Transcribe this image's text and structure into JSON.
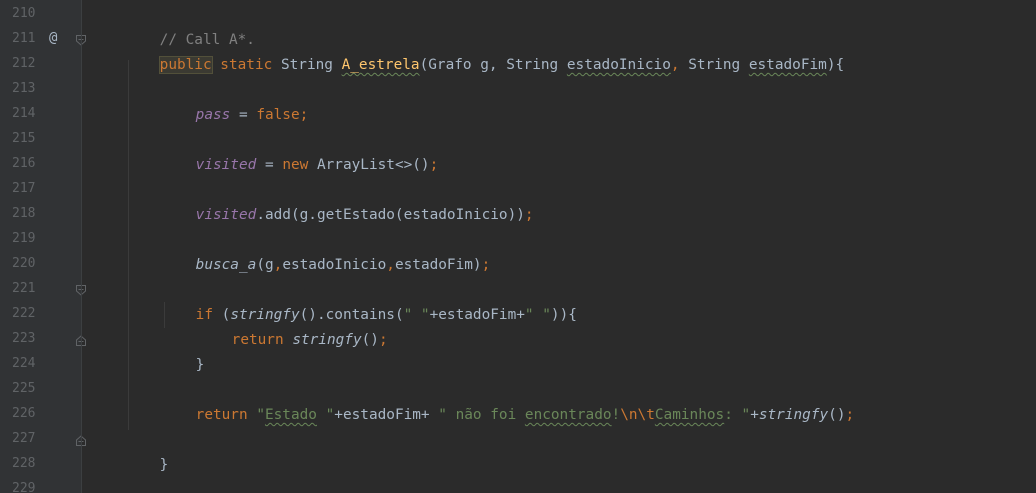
{
  "gutter": {
    "line_numbers": [
      "210",
      "211",
      "212",
      "213",
      "214",
      "215",
      "216",
      "217",
      "218",
      "219",
      "220",
      "221",
      "222",
      "223",
      "224",
      "225",
      "226",
      "227",
      "228",
      "229"
    ],
    "override_marker": "@"
  },
  "code": {
    "l210": {
      "comment": "// Call A*."
    },
    "l211": {
      "kw_public": "public",
      "kw_static": " static ",
      "type_string": "String ",
      "method_name": "A_estrela",
      "params_open": "(Grafo g, String ",
      "param_inicio": "estadoInicio",
      "comma": ", ",
      "type_string2": "String ",
      "param_fim": "estadoFim",
      "params_close": "){"
    },
    "l213": {
      "field": "pass",
      "op": " = ",
      "val": "false",
      "semi": ";"
    },
    "l215": {
      "field": "visited",
      "op": " = ",
      "kw_new": "new ",
      "rest": "ArrayList<>()",
      "semi": ";"
    },
    "l217": {
      "field": "visited",
      "rest": ".add(g.getEstado(estadoInicio))",
      "semi": ";"
    },
    "l219": {
      "call": "busca_a",
      "open": "(g",
      "c1": ",",
      "arg1": "estadoInicio",
      "c2": ",",
      "arg2": "estadoFim)",
      "semi": ";"
    },
    "l221": {
      "kw_if": "if ",
      "open": "(",
      "call": "stringfy",
      "mid": "().contains(",
      "s1": "\" \"",
      "concat": "+estadoFim+",
      "s2": "\" \"",
      "close": ")){"
    },
    "l222": {
      "kw_return": "return ",
      "call": "stringfy",
      "rest": "()",
      "semi": ";"
    },
    "l223": {
      "brace": "}"
    },
    "l225": {
      "kw_return": "return ",
      "s_open": "\"",
      "s_word": "Estado",
      "s_end": " \"",
      "concat1": "+estadoFim+ ",
      "s2_a": "\" não foi ",
      "s2_word": "encontrado",
      "s2_b": "!",
      "esc": "\\n\\t",
      "s2_word2": "Caminhos",
      "s2_c": ": \"",
      "concat2": "+",
      "call": "stringfy",
      "rest": "()",
      "semi": ";"
    },
    "l227": {
      "brace": "}"
    }
  },
  "colors": {
    "background": "#2b2b2b",
    "gutter": "#313335",
    "keyword": "#cc7832",
    "string": "#6a8759",
    "field": "#9876aa",
    "method": "#ffc66d",
    "comment": "#808080",
    "text": "#a9b7c6"
  }
}
